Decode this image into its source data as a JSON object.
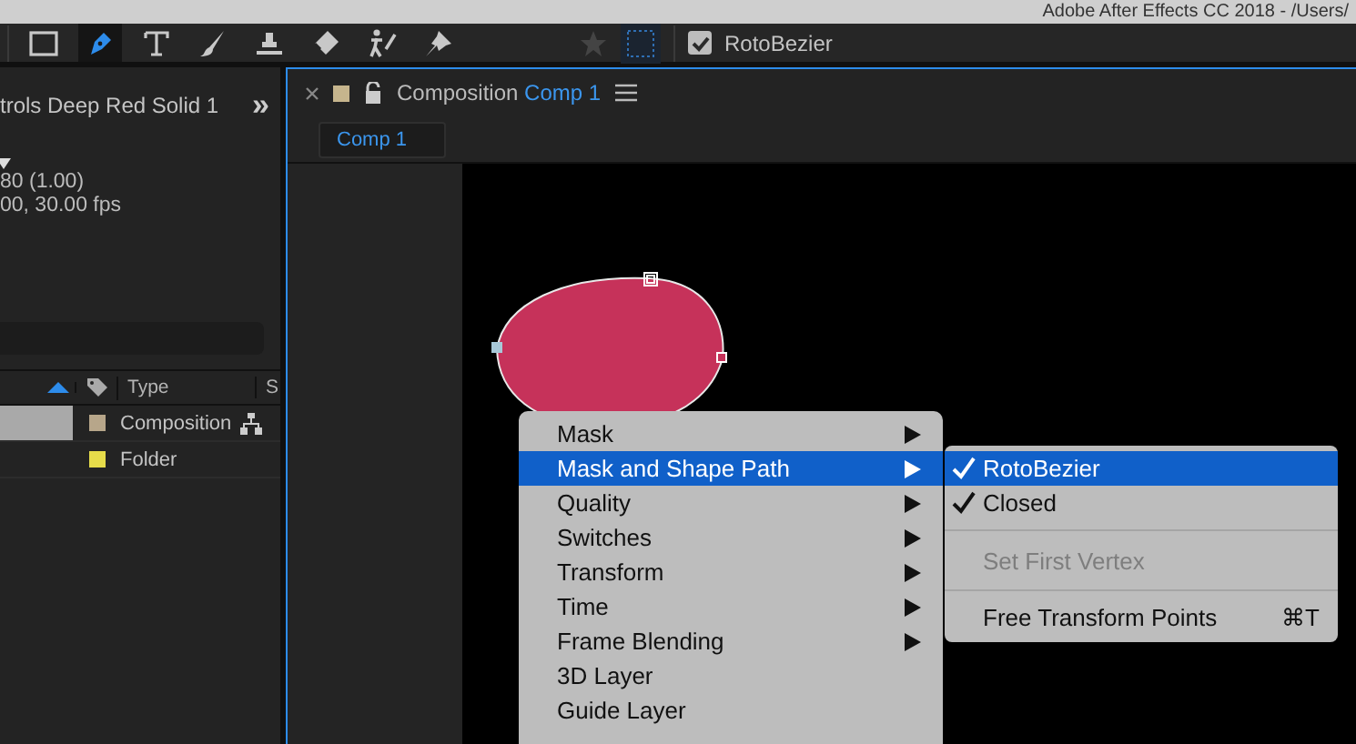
{
  "window": {
    "title": "Adobe After Effects CC 2018 - /Users/"
  },
  "toolbar": {
    "tools": [
      {
        "kind": "rectangle",
        "selected": false
      },
      {
        "kind": "pen",
        "selected": true
      },
      {
        "kind": "text",
        "selected": false
      },
      {
        "kind": "brush",
        "selected": false
      },
      {
        "kind": "stamp",
        "selected": false
      },
      {
        "kind": "eraser",
        "selected": false
      },
      {
        "kind": "puppet",
        "selected": false
      },
      {
        "kind": "pin",
        "selected": false
      }
    ],
    "rotobezier": {
      "label": "RotoBezier",
      "checked": true
    }
  },
  "left_panel": {
    "title": "trols Deep Red Solid 1",
    "expand": "»",
    "info_lines": [
      "80 (1.00)",
      "00, 30.00 fps"
    ],
    "columns": [
      {
        "kind": "sort"
      },
      {
        "kind": "label"
      },
      {
        "kind": "text",
        "label": "Type"
      },
      {
        "kind": "text",
        "label": "S"
      }
    ],
    "rows": [
      {
        "type": "Composition",
        "color": "#b7a68a",
        "selected": true,
        "flowchart": true
      },
      {
        "type": "Folder",
        "color": "#e6dc4a",
        "selected": false,
        "flowchart": false
      }
    ]
  },
  "composition_panel": {
    "prefix": "Composition",
    "name": "Comp 1",
    "tab": "Comp 1"
  },
  "context_menu": {
    "items": [
      {
        "label": "Mask",
        "submenu": true,
        "selected": false,
        "disabled": false
      },
      {
        "label": "Mask and Shape Path",
        "submenu": true,
        "selected": true,
        "disabled": false
      },
      {
        "label": "Quality",
        "submenu": true,
        "selected": false,
        "disabled": false
      },
      {
        "label": "Switches",
        "submenu": true,
        "selected": false,
        "disabled": false
      },
      {
        "label": "Transform",
        "submenu": true,
        "selected": false,
        "disabled": false
      },
      {
        "label": "Time",
        "submenu": true,
        "selected": false,
        "disabled": false
      },
      {
        "label": "Frame Blending",
        "submenu": true,
        "selected": false,
        "disabled": false
      },
      {
        "label": "3D Layer",
        "submenu": false,
        "selected": false,
        "disabled": false
      },
      {
        "label": "Guide Layer",
        "submenu": false,
        "selected": false,
        "disabled": false
      }
    ]
  },
  "submenu": {
    "items": [
      {
        "kind": "item",
        "label": "RotoBezier",
        "checked": true,
        "selected": true,
        "disabled": false
      },
      {
        "kind": "item",
        "label": "Closed",
        "checked": true,
        "selected": false,
        "disabled": false
      },
      {
        "kind": "separator"
      },
      {
        "kind": "item",
        "label": "Set First Vertex",
        "checked": false,
        "selected": false,
        "disabled": true
      },
      {
        "kind": "separator"
      },
      {
        "kind": "item",
        "label": "Free Transform Points",
        "shortcut": "⌘T",
        "checked": false,
        "selected": false,
        "disabled": false
      }
    ]
  }
}
